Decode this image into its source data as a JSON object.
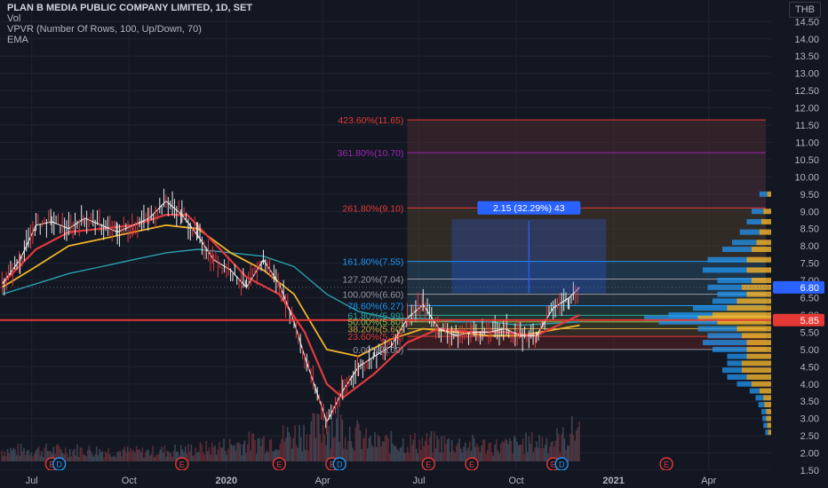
{
  "header": {
    "title": "PLAN B MEDIA PUBLIC COMPANY LIMITED, 1D, SET",
    "indicators": [
      "Vol",
      "VPVR (Number Of Rows, 100, Up/Down, 70)",
      "EMA"
    ],
    "currency": "THB"
  },
  "colors": {
    "background": "#131722",
    "grid": "#1f2330",
    "ema_red": "#e03a3e",
    "ema_orange": "#f0b429",
    "ema_teal": "#2a9fb0",
    "candle_up": "#e8e8e8",
    "candle_down": "#e03a3e",
    "vpvr_up": "#2196f3",
    "vpvr_down": "#f5b72e",
    "price_line": "#e53935",
    "badge_current": "#2962ff",
    "badge_red": "#e53935"
  },
  "chart_data": {
    "type": "line",
    "price_axis": {
      "ylim": [
        1.5,
        15.0
      ],
      "ticks": [
        "1.50",
        "2.00",
        "2.50",
        "3.00",
        "3.50",
        "4.00",
        "4.50",
        "5.00",
        "5.50",
        "6.00",
        "6.50",
        "7.00",
        "7.50",
        "8.00",
        "8.50",
        "9.00",
        "9.50",
        "10.00",
        "10.50",
        "11.00",
        "11.50",
        "12.00",
        "12.50",
        "13.00",
        "13.50",
        "14.00",
        "14.50"
      ]
    },
    "time_axis": {
      "labels": [
        "Jul",
        "Oct",
        "2020",
        "Apr",
        "Jul",
        "Oct",
        "2021",
        "Apr"
      ],
      "label_dates": [
        "2019-07-01",
        "2019-10-01",
        "2020-01-01",
        "2020-04-01",
        "2020-07-01",
        "2020-10-01",
        "2021-01-01",
        "2021-04-01"
      ],
      "range": [
        "2019-06-01",
        "2021-05-30"
      ]
    },
    "series": [
      {
        "role": "price",
        "x": [
          "2019-06-03",
          "2019-06-20",
          "2019-07-05",
          "2019-07-20",
          "2019-08-05",
          "2019-08-20",
          "2019-09-05",
          "2019-09-20",
          "2019-10-05",
          "2019-10-20",
          "2019-11-05",
          "2019-11-20",
          "2019-12-05",
          "2019-12-20",
          "2020-01-05",
          "2020-01-20",
          "2020-02-05",
          "2020-02-20",
          "2020-03-05",
          "2020-03-15",
          "2020-03-25",
          "2020-04-05",
          "2020-04-20",
          "2020-05-05",
          "2020-05-20",
          "2020-06-05",
          "2020-06-20",
          "2020-07-05",
          "2020-07-20",
          "2020-08-05",
          "2020-08-20",
          "2020-09-05",
          "2020-09-20",
          "2020-10-05",
          "2020-10-20",
          "2020-11-05",
          "2020-11-20",
          "2020-11-30"
        ],
        "values": [
          6.9,
          7.6,
          8.6,
          8.7,
          8.5,
          8.8,
          8.6,
          8.4,
          8.6,
          8.8,
          9.3,
          8.9,
          8.3,
          7.6,
          7.3,
          6.8,
          7.6,
          6.9,
          5.8,
          4.8,
          3.9,
          2.9,
          3.8,
          4.5,
          4.8,
          5.1,
          5.9,
          6.3,
          5.6,
          5.4,
          5.5,
          5.5,
          5.6,
          5.4,
          5.4,
          6.2,
          6.5,
          6.8
        ]
      },
      {
        "role": "ema_fast",
        "x": [
          "2019-06-03",
          "2019-07-05",
          "2019-08-05",
          "2019-09-05",
          "2019-10-05",
          "2019-11-05",
          "2019-11-25",
          "2019-12-20",
          "2020-01-20",
          "2020-02-20",
          "2020-03-15",
          "2020-04-05",
          "2020-04-20",
          "2020-05-20",
          "2020-06-20",
          "2020-07-20",
          "2020-08-20",
          "2020-09-20",
          "2020-10-20",
          "2020-11-30"
        ],
        "values": [
          6.9,
          7.9,
          8.4,
          8.5,
          8.6,
          8.9,
          8.9,
          8.1,
          7.1,
          6.6,
          5.5,
          4.0,
          3.6,
          4.3,
          5.2,
          5.6,
          5.5,
          5.5,
          5.4,
          6.0
        ]
      },
      {
        "role": "ema_mid",
        "x": [
          "2019-06-03",
          "2019-07-05",
          "2019-08-05",
          "2019-09-05",
          "2019-10-05",
          "2019-11-05",
          "2019-12-05",
          "2020-01-05",
          "2020-02-05",
          "2020-03-05",
          "2020-04-05",
          "2020-05-05",
          "2020-06-05",
          "2020-07-05",
          "2020-08-05",
          "2020-09-05",
          "2020-10-05",
          "2020-11-30"
        ],
        "values": [
          6.8,
          7.4,
          8.0,
          8.2,
          8.4,
          8.6,
          8.5,
          7.8,
          7.3,
          6.6,
          5.0,
          4.8,
          5.3,
          5.6,
          5.5,
          5.4,
          5.4,
          5.7
        ]
      },
      {
        "role": "ema_slow",
        "x": [
          "2019-06-03",
          "2019-07-05",
          "2019-08-05",
          "2019-09-05",
          "2019-10-05",
          "2019-11-05",
          "2019-12-05",
          "2020-01-05",
          "2020-02-05",
          "2020-03-05",
          "2020-04-05",
          "2020-05-05",
          "2020-06-05",
          "2020-07-05",
          "2020-08-05",
          "2020-09-05",
          "2020-10-05",
          "2020-11-30"
        ],
        "values": [
          6.6,
          6.9,
          7.2,
          7.4,
          7.6,
          7.8,
          7.9,
          7.8,
          7.7,
          7.4,
          6.6,
          6.1,
          5.9,
          5.9,
          5.8,
          5.8,
          5.7,
          5.8
        ]
      }
    ],
    "volume": {
      "x": [
        "2019-06-15",
        "2019-08-15",
        "2019-10-15",
        "2019-12-15",
        "2020-02-15",
        "2020-03-20",
        "2020-04-15",
        "2020-05-15",
        "2020-07-15",
        "2020-09-15",
        "2020-11-15",
        "2020-11-28"
      ],
      "values": [
        0.3,
        0.3,
        0.25,
        0.35,
        0.6,
        0.8,
        1.0,
        0.5,
        0.5,
        0.4,
        0.6,
        0.9
      ]
    },
    "fib": {
      "x_range": [
        "2020-06-20",
        "2021-05-25"
      ],
      "levels": [
        {
          "label": "0.00%(5.00)",
          "value": 5.0
        },
        {
          "label": "23.60%(5.38)",
          "value": 5.38
        },
        {
          "label": "38.20%(5.60)",
          "value": 5.6
        },
        {
          "label": "50.00%(5.80)",
          "value": 5.8
        },
        {
          "label": "61.80%(5.99)",
          "value": 5.99
        },
        {
          "label": "78.60%(6.27)",
          "value": 6.27
        },
        {
          "label": "100.00%(6.60)",
          "value": 6.6
        },
        {
          "label": "127.20%(7.04)",
          "value": 7.04
        },
        {
          "label": "161.80%(7.55)",
          "value": 7.55
        },
        {
          "label": "261.80%(9.10)",
          "value": 9.1
        },
        {
          "label": "361.80%(10.70)",
          "value": 10.7
        },
        {
          "label": "423.60%(11.65)",
          "value": 11.65
        }
      ]
    },
    "measure": {
      "label": "2.15 (32.29%) 43",
      "from": 6.63,
      "to": 8.78,
      "x_range": [
        "2020-08-01",
        "2020-12-25"
      ]
    },
    "horizontal_line": {
      "value": 5.85
    },
    "current_price": {
      "label": "6.80",
      "value": 6.8
    },
    "red_badge": {
      "label": "5.85",
      "value": 5.85
    },
    "vpvr": {
      "levels": [
        9.5,
        9.0,
        8.7,
        8.4,
        8.1,
        7.9,
        7.6,
        7.3,
        7.0,
        6.8,
        6.6,
        6.4,
        6.2,
        6.0,
        5.9,
        5.8,
        5.6,
        5.4,
        5.2,
        5.0,
        4.8,
        4.6,
        4.4,
        4.2,
        4.0,
        3.8,
        3.6,
        3.4,
        3.2,
        3.0,
        2.8,
        2.6
      ],
      "up": [
        0.08,
        0.12,
        0.15,
        0.2,
        0.25,
        0.3,
        0.4,
        0.45,
        0.35,
        0.35,
        0.3,
        0.25,
        0.35,
        0.45,
        0.55,
        0.6,
        0.4,
        0.35,
        0.45,
        0.35,
        0.2,
        0.15,
        0.2,
        0.2,
        0.15,
        0.1,
        0.08,
        0.06,
        0.05,
        0.04,
        0.04,
        0.03
      ],
      "down": [
        0.04,
        0.08,
        0.1,
        0.12,
        0.15,
        0.2,
        0.25,
        0.25,
        0.2,
        0.3,
        0.25,
        0.35,
        0.45,
        0.6,
        0.75,
        0.55,
        0.35,
        0.3,
        0.25,
        0.25,
        0.25,
        0.3,
        0.3,
        0.25,
        0.2,
        0.12,
        0.08,
        0.07,
        0.05,
        0.05,
        0.04,
        0.03
      ]
    },
    "events": [
      {
        "date": "2019-07-20",
        "kind": "E"
      },
      {
        "date": "2019-07-27",
        "kind": "D"
      },
      {
        "date": "2019-11-20",
        "kind": "E"
      },
      {
        "date": "2020-02-20",
        "kind": "E"
      },
      {
        "date": "2020-04-10",
        "kind": "E"
      },
      {
        "date": "2020-04-17",
        "kind": "D"
      },
      {
        "date": "2020-07-10",
        "kind": "E"
      },
      {
        "date": "2020-08-20",
        "kind": "E"
      },
      {
        "date": "2020-11-05",
        "kind": "E"
      },
      {
        "date": "2020-11-13",
        "kind": "D"
      },
      {
        "date": "2021-02-20",
        "kind": "E"
      }
    ]
  }
}
